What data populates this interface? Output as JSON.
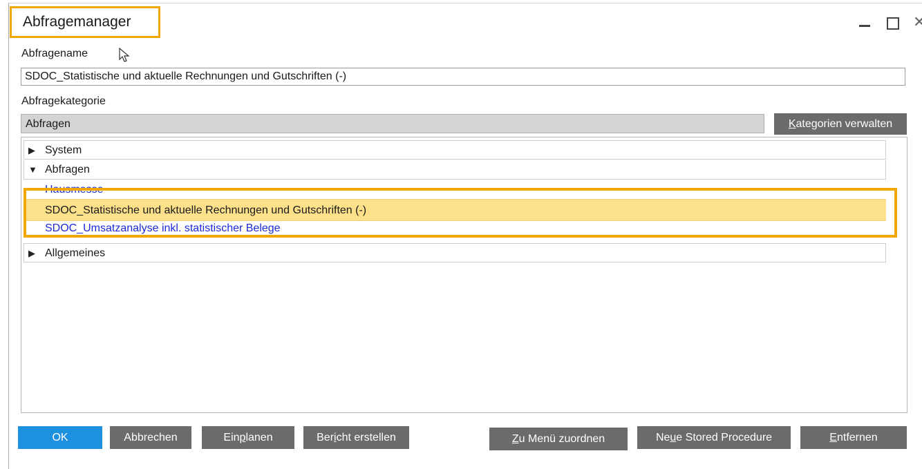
{
  "window": {
    "title": "Abfragemanager",
    "controls": {
      "minimize": "—",
      "maximize": "□",
      "close": "✕"
    }
  },
  "form": {
    "name_label": "Abfragename",
    "name_value": "SDOC_Statistische und aktuelle Rechnungen und Gutschriften (-)",
    "category_label": "Abfragekategorie",
    "category_value": "Abfragen",
    "manage_categories_button": {
      "first_letter": "K",
      "rest": "ategorien verwalten"
    }
  },
  "tree": {
    "system": {
      "arrow": "▶",
      "label": "System"
    },
    "abfragen": {
      "arrow": "▼",
      "label": "Abfragen"
    },
    "children": {
      "hausmesse": "Hausmesse",
      "sdoc_statistische": "SDOC_Statistische und aktuelle Rechnungen und Gutschriften (-)",
      "sdoc_umsatz": "SDOC_Umsatzanalyse inkl. statistischer Belege"
    },
    "allgemeines": {
      "arrow": "▶",
      "label": "Allgemeines"
    }
  },
  "buttons": {
    "ok": "OK",
    "cancel": "Abbrechen",
    "schedule": {
      "pre": "Ein",
      "u": "p",
      "post": "lanen"
    },
    "report": {
      "pre": "Ber",
      "u": "i",
      "post": "cht erstellen"
    },
    "assign_menu": {
      "pre": "",
      "u": "Z",
      "post": "u Menü zuordnen"
    },
    "new_stored_procedure": {
      "pre": "Ne",
      "u": "u",
      "post": "e Stored Procedure"
    },
    "remove": {
      "pre": "",
      "u": "E",
      "post": "ntfernen"
    }
  },
  "colors": {
    "highlight_border": "#f0a800",
    "selected_row": "#fde08a",
    "ok_button": "#1e90e0",
    "gray_button": "#6b6b6b",
    "link_text": "#1c2bd6"
  }
}
